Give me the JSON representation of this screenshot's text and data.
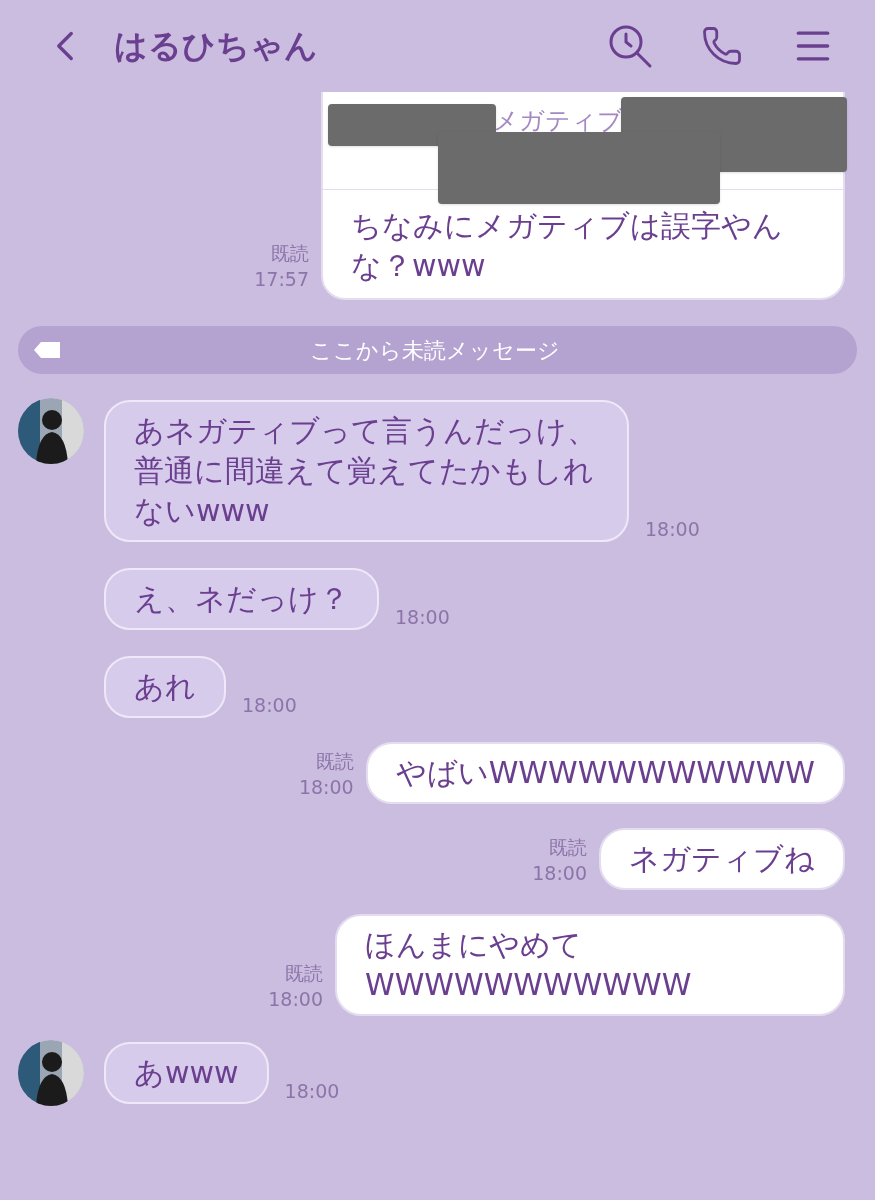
{
  "header": {
    "title": "はるひちゃん"
  },
  "quote": {
    "snippet": "メガティブ",
    "text": "ちなみにメガティブは誤字やんな？www",
    "read": "既読",
    "time": "17:57"
  },
  "unread_divider": {
    "label": "ここから未読メッセージ"
  },
  "messages": [
    {
      "kind": "incoming",
      "avatar": true,
      "text": "あネガティブって言うんだっけ、普通に間違えて覚えてたかもしれないwww",
      "time": "18:00"
    },
    {
      "kind": "incoming",
      "avatar": false,
      "text": "え、ネだっけ？",
      "time": "18:00"
    },
    {
      "kind": "incoming",
      "avatar": false,
      "text": "あれ",
      "time": "18:00"
    },
    {
      "kind": "outgoing",
      "read": "既読",
      "text": "やばいWWWWWWWWWWW",
      "time": "18:00"
    },
    {
      "kind": "outgoing",
      "read": "既読",
      "text": "ネガティブね",
      "time": "18:00"
    },
    {
      "kind": "outgoing",
      "read": "既読",
      "text": "ほんまにやめてWWWWWWWWWWW",
      "time": "18:00"
    },
    {
      "kind": "incoming",
      "avatar": true,
      "text": "あwww",
      "time": "18:00"
    }
  ]
}
